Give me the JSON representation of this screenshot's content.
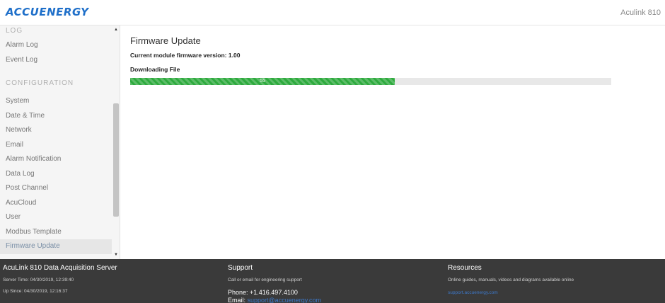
{
  "header": {
    "logo_text": "ACCUENERGY",
    "device_name": "Aculink 810"
  },
  "sidebar": {
    "section_log": "LOG",
    "log_items": [
      {
        "label": "Alarm Log"
      },
      {
        "label": "Event Log"
      }
    ],
    "section_configuration": "CONFIGURATION",
    "config_items": [
      {
        "label": "System"
      },
      {
        "label": "Date & Time"
      },
      {
        "label": "Network"
      },
      {
        "label": "Email"
      },
      {
        "label": "Alarm Notification"
      },
      {
        "label": "Data Log"
      },
      {
        "label": "Post Channel"
      },
      {
        "label": "AcuCloud"
      },
      {
        "label": "User"
      },
      {
        "label": "Modbus Template"
      },
      {
        "label": "Firmware Update"
      }
    ],
    "active_item": "Firmware Update"
  },
  "main": {
    "title": "Firmware Update",
    "version_label": "Current module firmware version:",
    "version_value": "1.00",
    "status": "Downloading File",
    "progress_percent": 55,
    "progress_text": "55"
  },
  "footer": {
    "server": {
      "title": "AcuLink 810 Data Acquisition Server",
      "server_time": "Server Time: 04/30/2019, 12:39:40",
      "up_since": "Up Since: 04/30/2019, 12:16:37"
    },
    "support": {
      "title": "Support",
      "description": "Call or email for engineering support",
      "phone": "Phone: +1.416.497.4100",
      "email_label": "Email:",
      "email": "support@accuenergy.com"
    },
    "resources": {
      "title": "Resources",
      "description": "Online guides, manuals, videos and diagrams available online",
      "link": "support.accuenergy.com"
    }
  },
  "colors": {
    "brand": "#1e6fc9",
    "progress": "#2eaa3e",
    "footer_bg": "#3a3a3a",
    "link": "#3d78c9"
  }
}
